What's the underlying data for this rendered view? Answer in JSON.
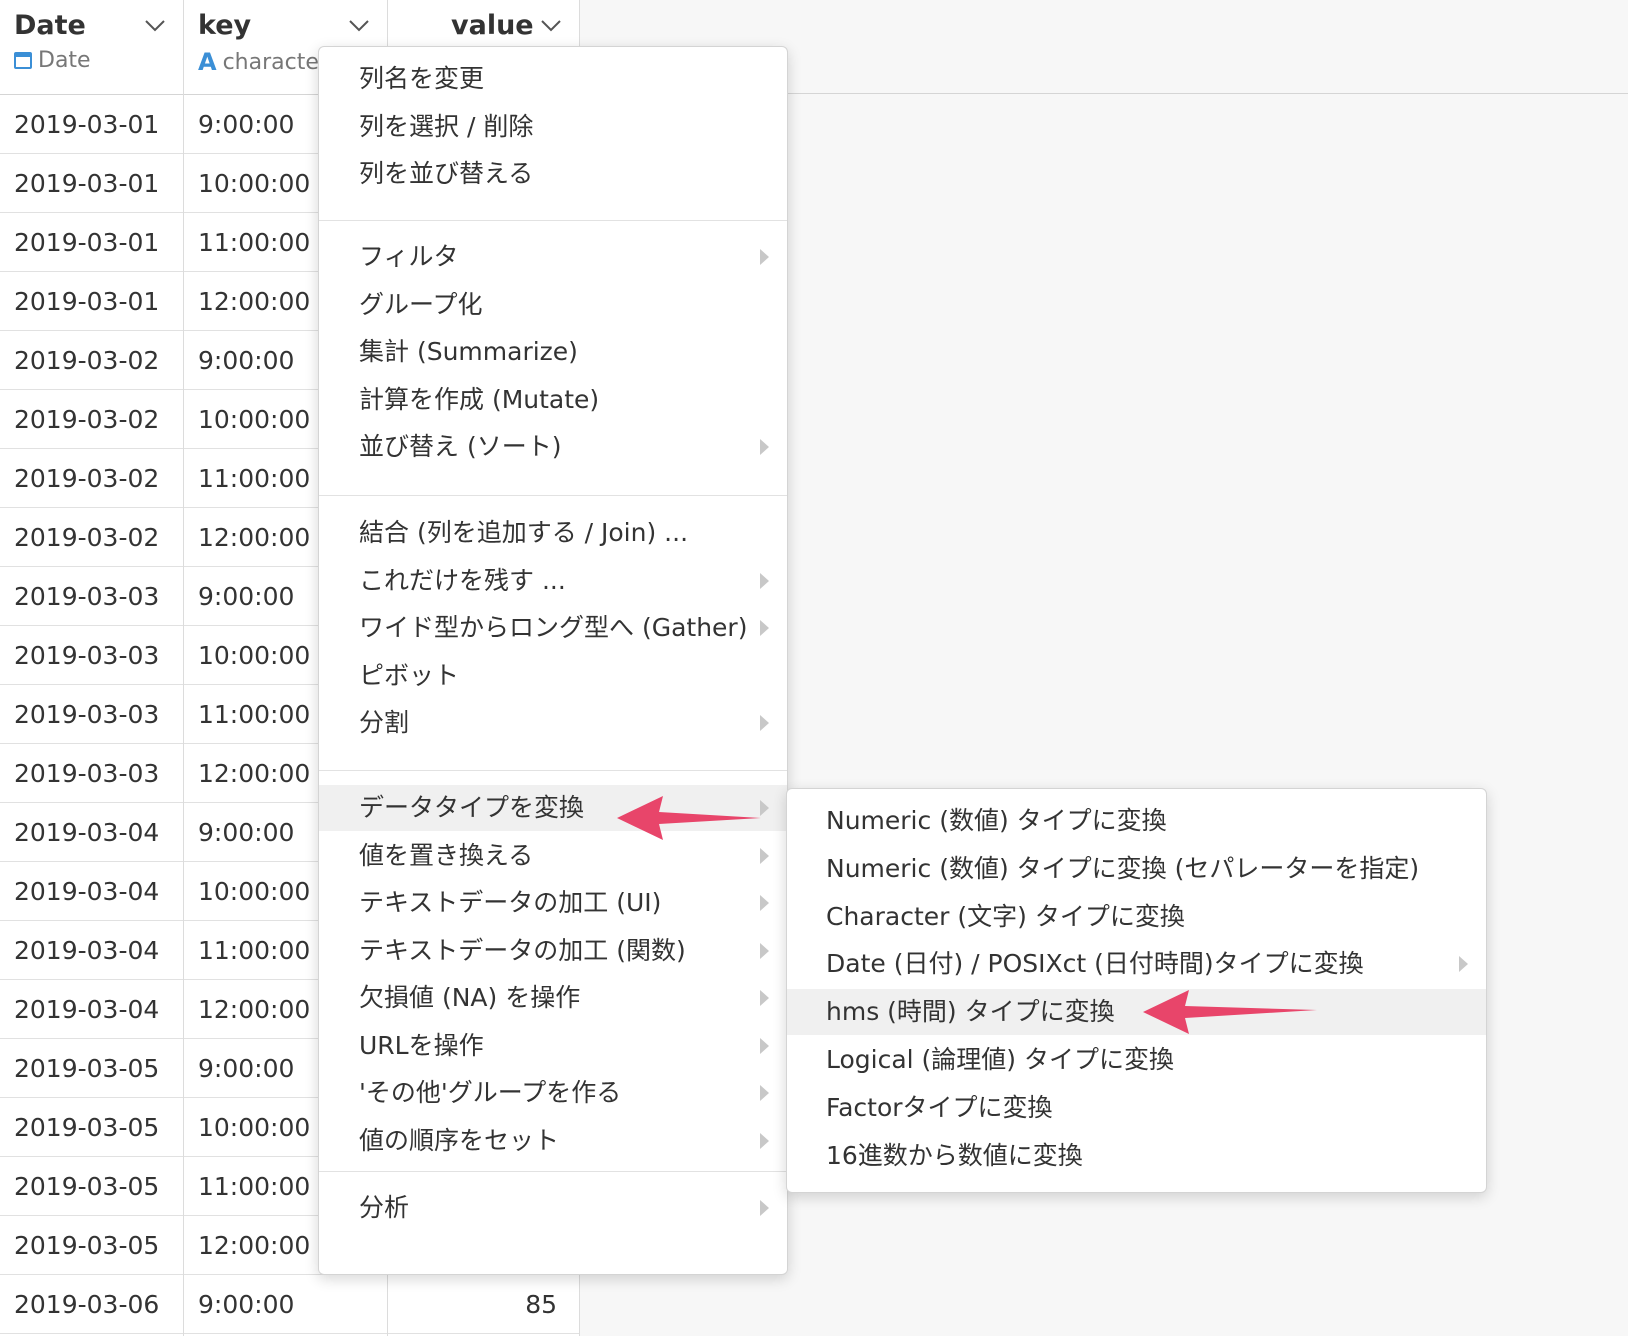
{
  "columns": [
    {
      "name": "Date",
      "type": "Date",
      "type_icon": "calendar-icon"
    },
    {
      "name": "key",
      "type": "characte",
      "type_icon": "character-type-icon"
    },
    {
      "name": "value"
    }
  ],
  "rows": [
    {
      "date": "2019-03-01",
      "key": "9:00:00"
    },
    {
      "date": "2019-03-01",
      "key": "10:00:00"
    },
    {
      "date": "2019-03-01",
      "key": "11:00:00"
    },
    {
      "date": "2019-03-01",
      "key": "12:00:00"
    },
    {
      "date": "2019-03-02",
      "key": "9:00:00"
    },
    {
      "date": "2019-03-02",
      "key": "10:00:00"
    },
    {
      "date": "2019-03-02",
      "key": "11:00:00"
    },
    {
      "date": "2019-03-02",
      "key": "12:00:00"
    },
    {
      "date": "2019-03-03",
      "key": "9:00:00"
    },
    {
      "date": "2019-03-03",
      "key": "10:00:00"
    },
    {
      "date": "2019-03-03",
      "key": "11:00:00"
    },
    {
      "date": "2019-03-03",
      "key": "12:00:00"
    },
    {
      "date": "2019-03-04",
      "key": "9:00:00"
    },
    {
      "date": "2019-03-04",
      "key": "10:00:00"
    },
    {
      "date": "2019-03-04",
      "key": "11:00:00"
    },
    {
      "date": "2019-03-04",
      "key": "12:00:00"
    },
    {
      "date": "2019-03-05",
      "key": "9:00:00"
    },
    {
      "date": "2019-03-05",
      "key": "10:00:00"
    },
    {
      "date": "2019-03-05",
      "key": "11:00:00"
    },
    {
      "date": "2019-03-05",
      "key": "12:00:00"
    },
    {
      "date": "2019-03-06",
      "key": "9:00:00",
      "value": "85"
    }
  ],
  "context_menu": {
    "groups": [
      [
        {
          "label": "列名を変更"
        },
        {
          "label": "列を選択 / 削除"
        },
        {
          "label": "列を並び替える"
        }
      ],
      [
        {
          "label": "フィルタ",
          "submenu": true
        },
        {
          "label": "グループ化"
        },
        {
          "label": "集計 (Summarize)"
        },
        {
          "label": "計算を作成 (Mutate)"
        },
        {
          "label": "並び替え (ソート)",
          "submenu": true
        }
      ],
      [
        {
          "label": "結合 (列を追加する / Join) ..."
        },
        {
          "label": "これだけを残す ...",
          "submenu": true
        },
        {
          "label": "ワイド型からロング型へ (Gather)",
          "submenu": true
        },
        {
          "label": "ピボット"
        },
        {
          "label": "分割",
          "submenu": true
        }
      ],
      [
        {
          "label": "データタイプを変換",
          "highlighted": true,
          "submenu": true
        },
        {
          "label": "値を置き換える",
          "submenu": true
        },
        {
          "label": "テキストデータの加工 (UI)",
          "submenu": true
        },
        {
          "label": "テキストデータの加工 (関数)",
          "submenu": true
        },
        {
          "label": "欠損値 (NA) を操作",
          "submenu": true
        },
        {
          "label": "URLを操作",
          "submenu": true
        },
        {
          "label": "'その他'グループを作る",
          "submenu": true
        },
        {
          "label": "値の順序をセット",
          "submenu": true
        }
      ],
      [
        {
          "label": "分析",
          "submenu": true
        }
      ]
    ]
  },
  "submenu": {
    "items": [
      {
        "label": "Numeric (数値) タイプに変換"
      },
      {
        "label": "Numeric (数値) タイプに変換 (セパレーターを指定)"
      },
      {
        "label": "Character (文字) タイプに変換"
      },
      {
        "label": "Date (日付) / POSIXct (日付時間)タイプに変換",
        "submenu": true
      },
      {
        "label": "hms (時間) タイプに変換",
        "highlighted": true
      },
      {
        "label": "Logical (論理値) タイプに変換"
      },
      {
        "label": "Factorタイプに変換"
      },
      {
        "label": "16進数から数値に変換"
      }
    ]
  },
  "colors": {
    "accent_arrow": "#e8456a",
    "type_icon": "#3b8fd6",
    "highlight": "#f0f0f0"
  }
}
